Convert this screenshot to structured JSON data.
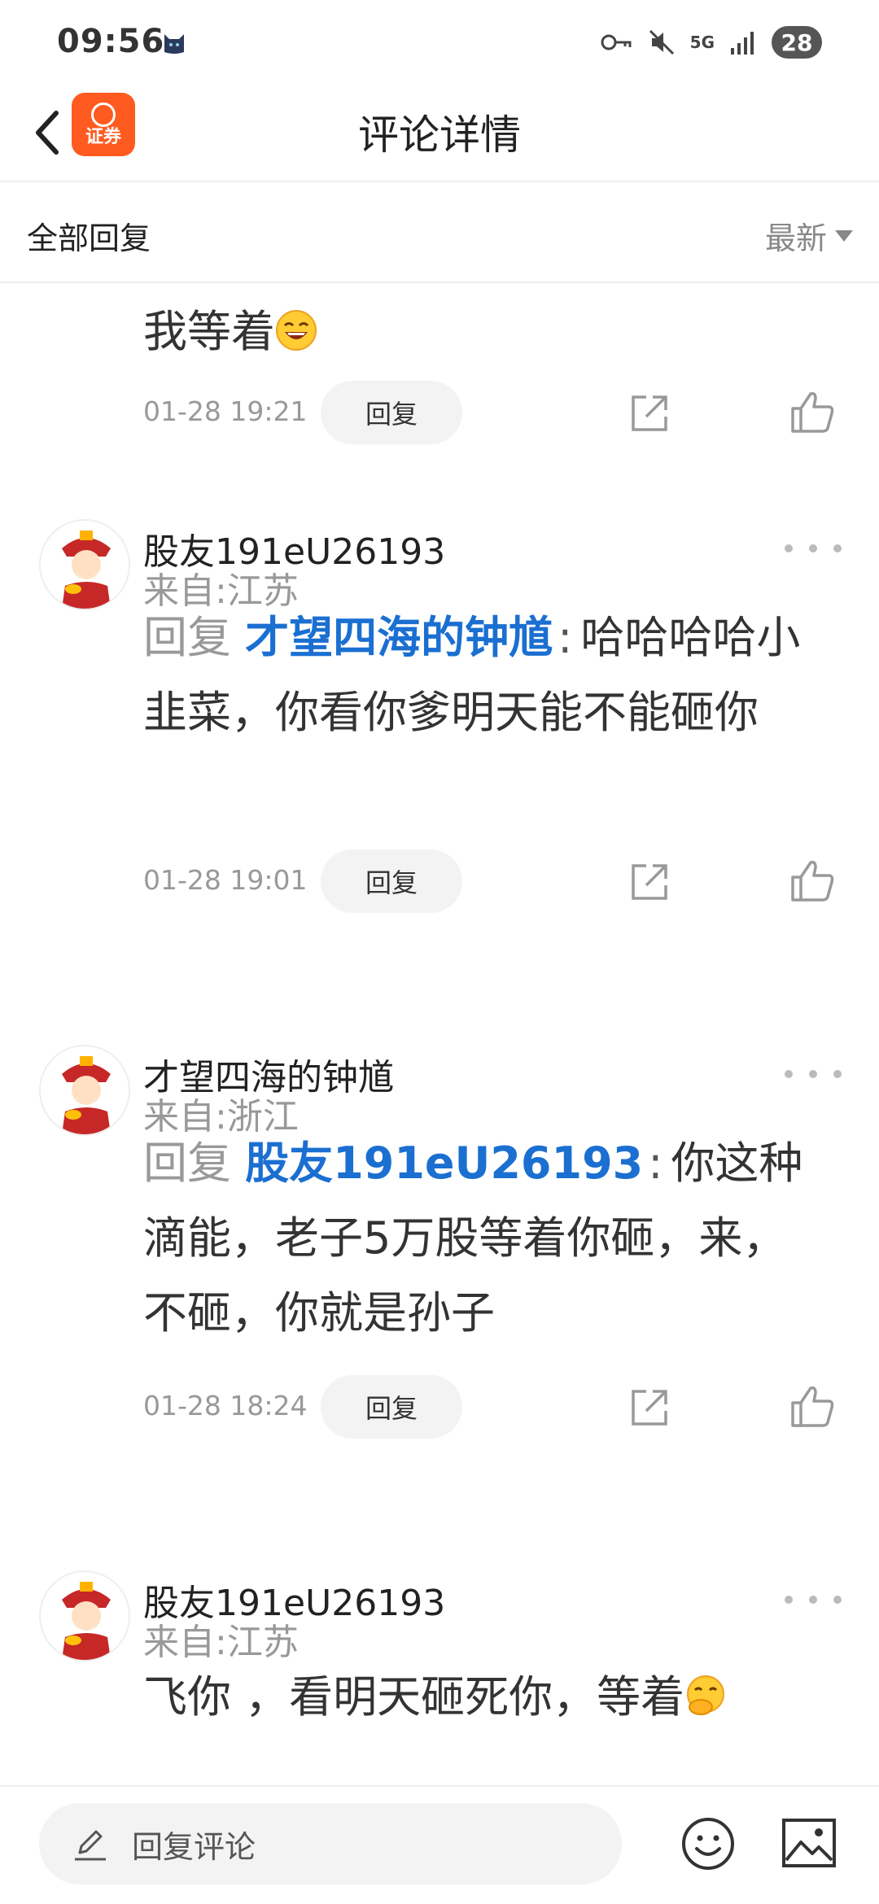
{
  "status": {
    "time": "09:56",
    "network": "5G",
    "battery": "28"
  },
  "header": {
    "title": "评论详情",
    "logo_text": "证券"
  },
  "filter": {
    "label": "全部回复",
    "sort": "最新"
  },
  "comments": [
    {
      "body": "我等着",
      "emoji": "laughing-emoji",
      "time": "01-28 19:21",
      "reply_label": "回复"
    },
    {
      "user": "股友191eU26193",
      "location": "来自:江苏",
      "reply_prefix": "回复",
      "mention": "才望四海的钟馗",
      "colon": ":",
      "body": "哈哈哈哈小韭菜，你看你爹明天能不能砸你",
      "time": "01-28 19:01",
      "reply_label": "回复"
    },
    {
      "user": "才望四海的钟馗",
      "location": "来自:浙江",
      "reply_prefix": "回复",
      "mention": "股友191eU26193",
      "colon": ":",
      "body": "你这种滴能，老子5万股等着你砸，来，不砸，你就是孙子",
      "time": "01-28 18:24",
      "reply_label": "回复"
    },
    {
      "user": "股友191eU26193",
      "location": "来自:江苏",
      "body": "飞你 ，看明天砸死你，等着",
      "emoji": "hand-over-mouth-emoji"
    }
  ],
  "bottom": {
    "placeholder": "回复评论"
  },
  "colors": {
    "accent": "#ff5a1f",
    "mention": "#1a6fd1",
    "muted": "#999999"
  }
}
